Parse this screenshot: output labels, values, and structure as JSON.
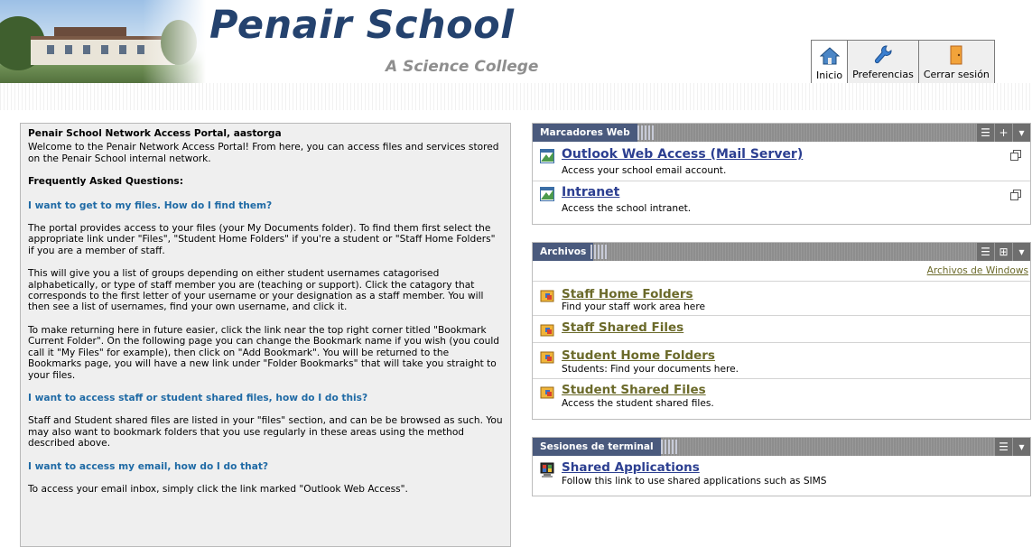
{
  "header": {
    "school_name": "Penair School",
    "subtitle": "A Science College"
  },
  "toolbar": {
    "items": [
      {
        "label": "Inicio",
        "icon": "home-icon"
      },
      {
        "label": "Preferencias",
        "icon": "wrench-icon"
      },
      {
        "label": "Cerrar sesión",
        "icon": "door-exit-icon"
      }
    ]
  },
  "welcome": {
    "title": "Penair School Network Access Portal, aastorga",
    "intro": "Welcome to the Penair Network Access Portal! From here, you can access files and services stored on the Penair School internal network.",
    "faq_heading": "Frequently Asked Questions:",
    "q1": "I want to get to my files. How do I find them?",
    "a1_p1": "The portal provides access to your files (your My Documents folder). To find them first select the appropriate link under \"Files\", \"Student Home Folders\" if you're a student or \"Staff Home Folders\" if you are a member of staff.",
    "a1_p2": "This will give you a list of groups depending on either student usernames catagorised alphabetically, or type of staff member you are (teaching or support). Click the catagory that corresponds to the first letter of your username or your designation as a staff member. You will then see a list of usernames, find your own username, and click it.",
    "a1_p3": "To make returning here in future easier, click the link near the top right corner titled \"Bookmark Current Folder\". On the following page you can change the Bookmark name if you wish (you could call it \"My Files\" for example), then click on \"Add Bookmark\". You will be returned to the Bookmarks page, you will have a new link under \"Folder Bookmarks\" that will take you straight to your files.",
    "q2": "I want to access staff or student shared files, how do I do this?",
    "a2": "Staff and Student shared files are listed in your \"files\" section, and can be be browsed as such. You may also want to bookmark folders that you use regularly in these areas using the method described above.",
    "q3": "I want to access my email, how do I do that?",
    "a3": "To access your email inbox, simply click the link marked \"Outlook Web Access\"."
  },
  "bookmarks": {
    "title": "Marcadores Web",
    "items": [
      {
        "label": "Outlook Web Access (Mail Server)",
        "desc": "Access your school email account."
      },
      {
        "label": "Intranet",
        "desc": "Access the school intranet."
      }
    ]
  },
  "files": {
    "title": "Archivos",
    "windows_link": "Archivos de Windows",
    "items": [
      {
        "label": "Staff Home Folders",
        "desc": "Find your staff work area here"
      },
      {
        "label": "Staff Shared Files",
        "desc": ""
      },
      {
        "label": "Student Home Folders",
        "desc": "Students: Find your documents here."
      },
      {
        "label": "Student Shared Files",
        "desc": "Access the student shared files."
      }
    ]
  },
  "terminal": {
    "title": "Sesiones de terminal",
    "items": [
      {
        "label": "Shared Applications",
        "desc": "Follow this link to use shared applications such as SIMS"
      }
    ]
  },
  "colors": {
    "title_blue": "#24426e",
    "panel_header": "#4a5a7d",
    "question_blue": "#1f6aa5",
    "file_link": "#6b6a2a"
  }
}
